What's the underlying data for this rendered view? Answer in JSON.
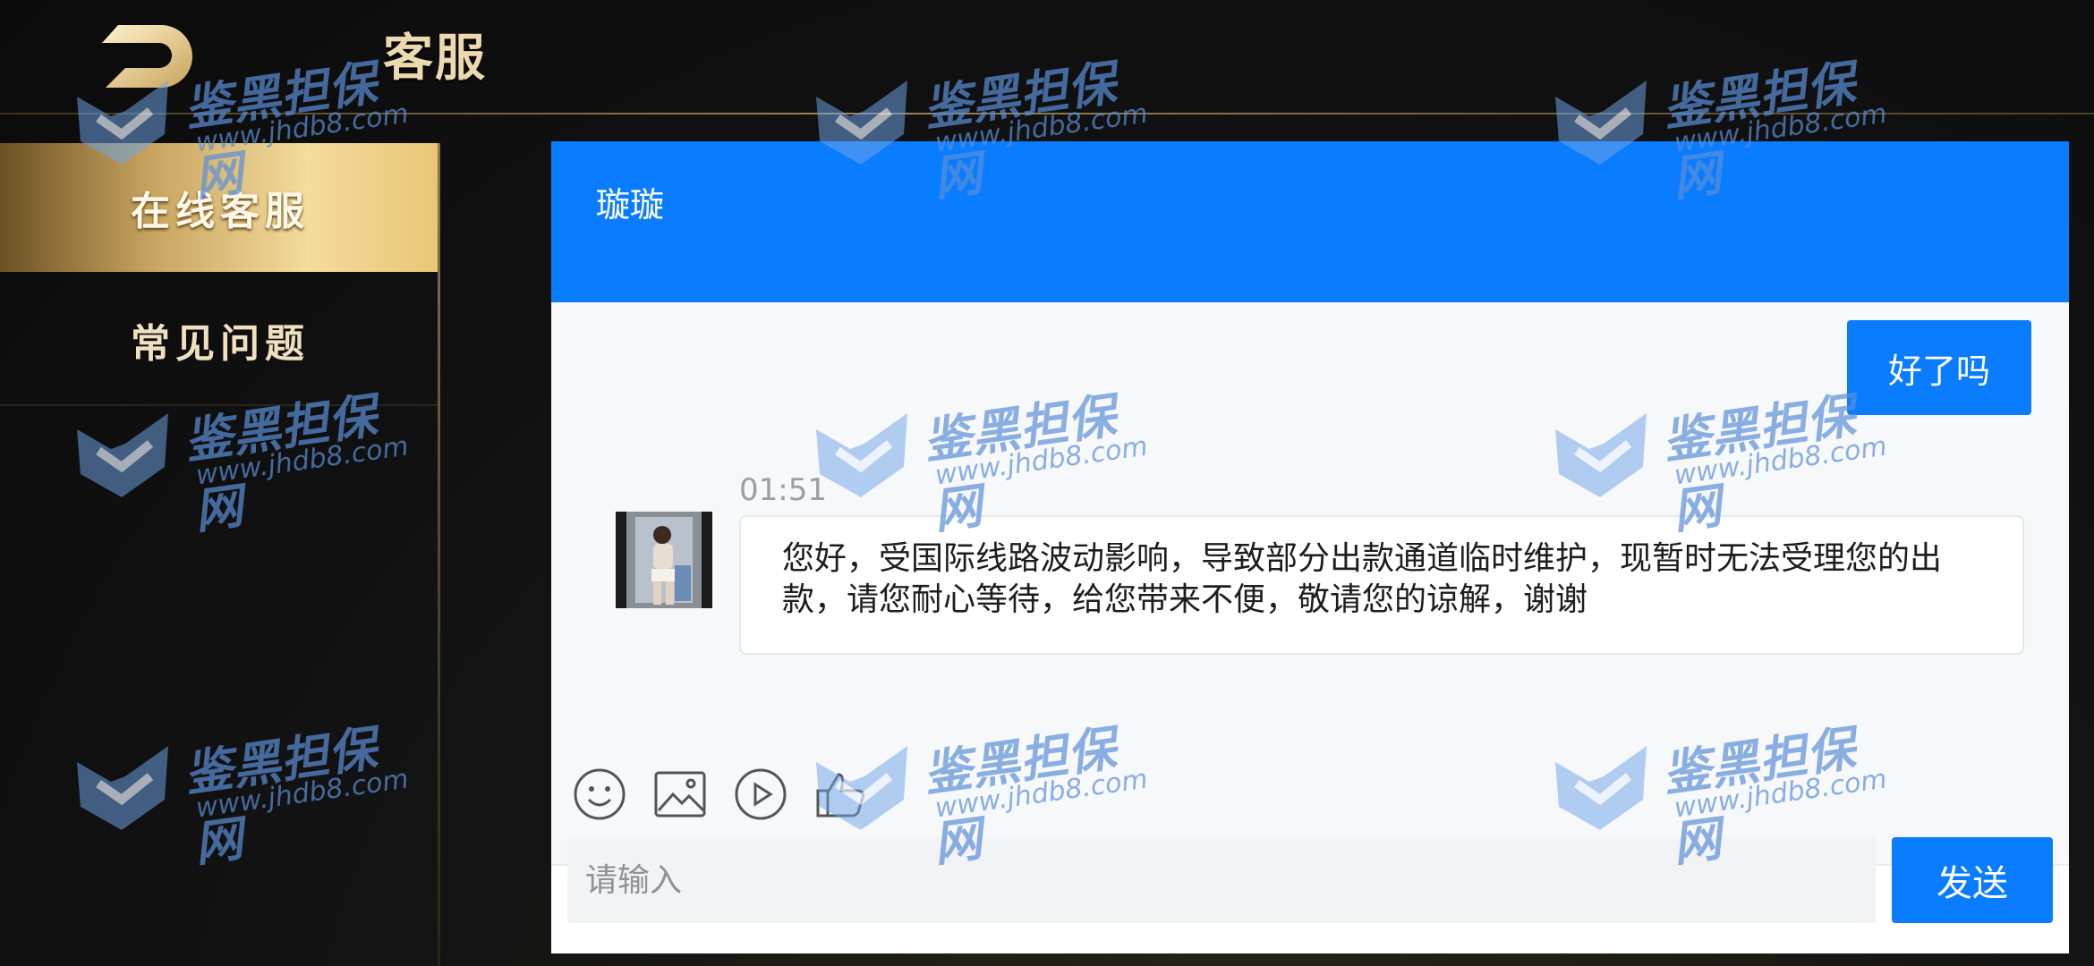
{
  "header": {
    "title": "客服"
  },
  "sidebar": {
    "items": [
      {
        "label": "在线客服",
        "active": true
      },
      {
        "label": "常见问题",
        "active": false
      }
    ]
  },
  "chat": {
    "agent_name": "璇璇",
    "messages": [
      {
        "from": "user",
        "text": "好了吗"
      },
      {
        "from": "agent",
        "time": "01:51",
        "text": "您好，受国际线路波动影响，导致部分出款通道临时维护，现暂时无法受理您的出款，请您耐心等待，给您带来不便，敬请您的谅解，谢谢"
      }
    ],
    "toolbar": [
      "emoji-icon",
      "image-icon",
      "video-icon",
      "thumbs-up-icon"
    ],
    "input_placeholder": "请输入",
    "send_label": "发送"
  },
  "watermark": {
    "text": "鉴黑担保网",
    "url": "www.jhdb8.com"
  },
  "colors": {
    "accent": "#0a7cff",
    "gold": "#e8c675",
    "background": "#111111"
  }
}
